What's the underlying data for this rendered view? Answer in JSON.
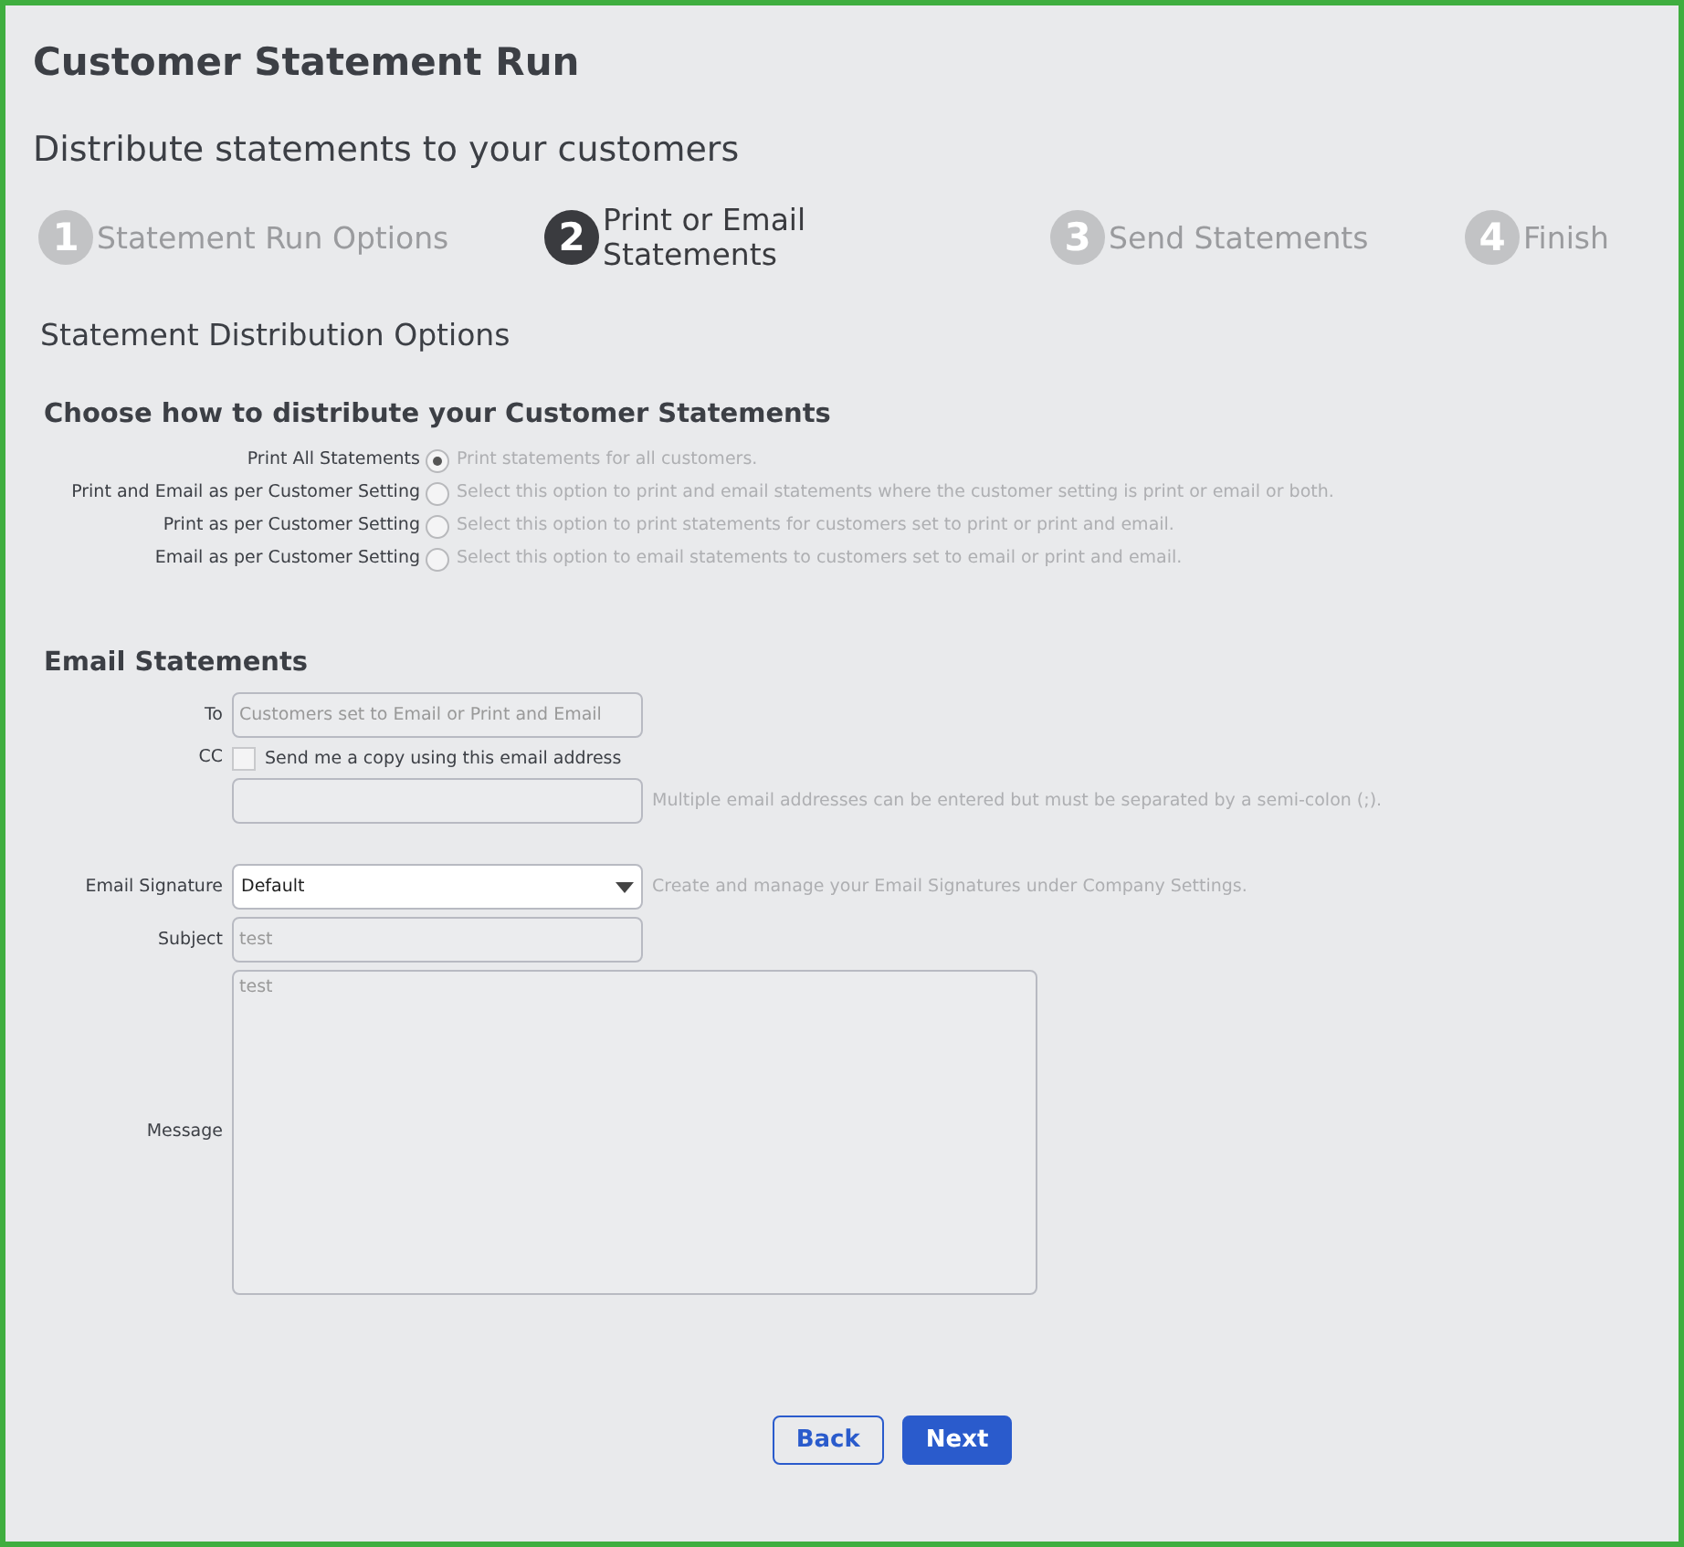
{
  "title": "Customer Statement Run",
  "subtitle": "Distribute statements to your customers",
  "steps": [
    {
      "number": "1",
      "label": "Statement Run Options",
      "selected": false
    },
    {
      "number": "2",
      "label": "Print or Email Statements",
      "selected": true
    },
    {
      "number": "3",
      "label": "Send Statements",
      "selected": false
    },
    {
      "number": "4",
      "label": "Finish",
      "selected": false
    }
  ],
  "section_title": "Statement Distribution Options",
  "distribution": {
    "heading": "Choose how to distribute your Customer Statements",
    "options": [
      {
        "label": "Print All Statements",
        "description": "Print statements for all customers.",
        "selected": true
      },
      {
        "label": "Print and Email as per Customer Setting",
        "description": "Select this option to print and email statements where the customer setting is print or email or both.",
        "selected": false
      },
      {
        "label": "Print as per Customer Setting",
        "description": "Select this option to print statements for customers set to print or print and email.",
        "selected": false
      },
      {
        "label": "Email as per Customer Setting",
        "description": "Select this option to email statements to customers set to email or print and email.",
        "selected": false
      }
    ]
  },
  "email": {
    "heading": "Email Statements",
    "to": {
      "label": "To",
      "value": "Customers set to Email or Print and Email",
      "disabled": true
    },
    "cc": {
      "label": "CC",
      "checkbox_label": "Send me a copy using this email address",
      "checked": false,
      "hint": "Multiple email addresses can be entered but must be separated by a semi-colon (;)."
    },
    "signature": {
      "label": "Email Signature",
      "value": "Default",
      "hint": "Create and manage your Email Signatures under Company Settings."
    },
    "subject": {
      "label": "Subject",
      "value": "test",
      "disabled": true
    },
    "message": {
      "label": "Message",
      "value": "test",
      "disabled": true
    }
  },
  "buttons": [
    {
      "label": "Back",
      "kind": "secondary"
    },
    {
      "label": "Next",
      "kind": "primary"
    }
  ]
}
